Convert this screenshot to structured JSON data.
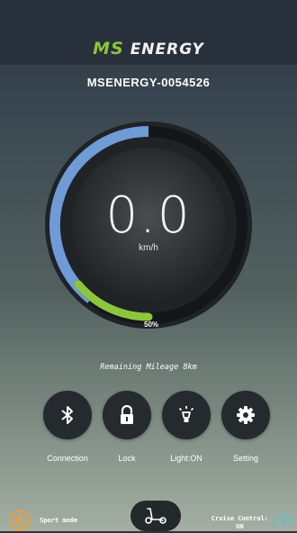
{
  "header": {
    "logo_ms": "MS",
    "logo_energy": "ENERGY",
    "device_name": "MSENERGY-0054526"
  },
  "dashboard": {
    "speed": "0.0",
    "speed_unit": "km/h",
    "battery_percent": "50%",
    "battery_level": 0.5,
    "mileage": "Remaining Mileage 8km"
  },
  "controls": [
    {
      "label": "Connection",
      "icon": "bluetooth-icon"
    },
    {
      "label": "Lock",
      "icon": "lock-icon"
    },
    {
      "label": "Light:ON",
      "icon": "light-icon"
    },
    {
      "label": "Setting",
      "icon": "gear-icon"
    }
  ],
  "bottom": {
    "sport_mode": "Sport mode",
    "cruise_line1": "Cruise Control:",
    "cruise_line2": "ON"
  },
  "colors": {
    "accent_green": "#8cc63f",
    "arc_blue": "#6f9bd6",
    "icon_orange": "#f0a12a",
    "cruise_teal": "#4fc3d1"
  }
}
